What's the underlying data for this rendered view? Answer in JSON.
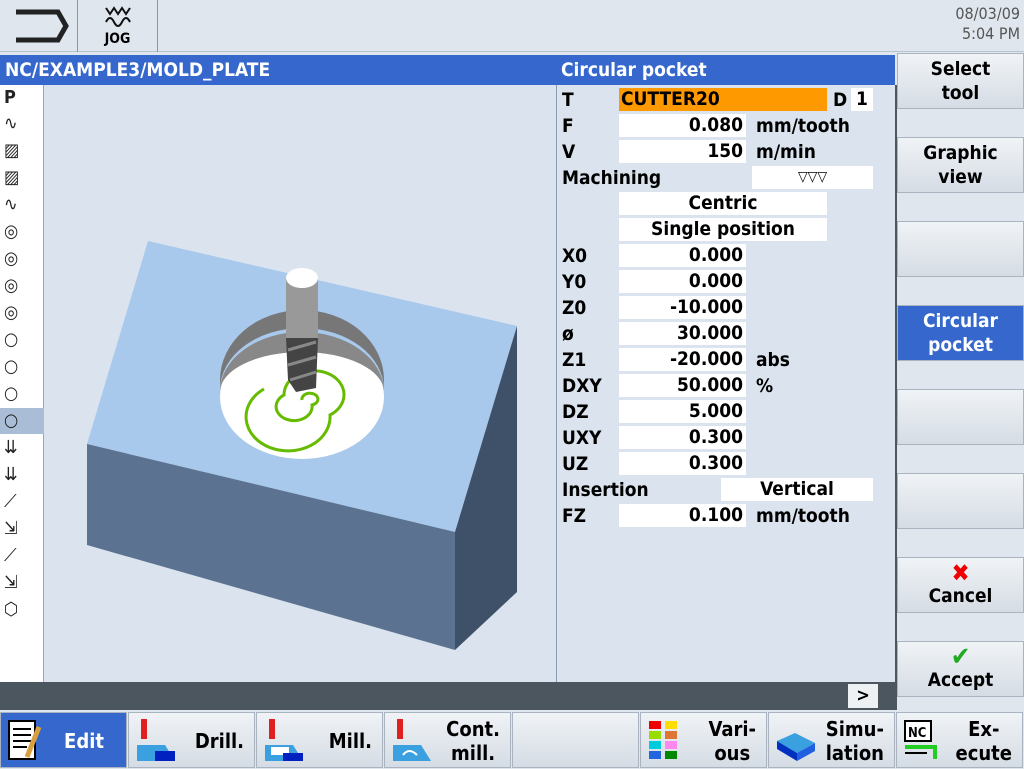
{
  "header": {
    "mode_label": "JOG",
    "date": "08/03/09",
    "time": "5:04 PM"
  },
  "title": {
    "path": "NC/EXAMPLE3/MOLD_PLATE",
    "cycle": "Circular pocket"
  },
  "left_strip": {
    "top_label": "P"
  },
  "form": {
    "tool_label": "T",
    "tool_value": "CUTTER20",
    "d_label": "D",
    "d_value": "1",
    "rows": [
      {
        "label": "F",
        "value": "0.080",
        "unit": "mm/tooth"
      },
      {
        "label": "V",
        "value": "150",
        "unit": "m/min"
      }
    ],
    "machining_label": "Machining",
    "machining_value": "▽▽▽",
    "option1": "Centric",
    "option2": "Single position",
    "params": [
      {
        "label": "X0",
        "value": "0.000",
        "unit": ""
      },
      {
        "label": "Y0",
        "value": "0.000",
        "unit": ""
      },
      {
        "label": "Z0",
        "value": "-10.000",
        "unit": ""
      },
      {
        "label": "ø",
        "value": "30.000",
        "unit": ""
      },
      {
        "label": "Z1",
        "value": "-20.000",
        "unit": "abs"
      },
      {
        "label": "DXY",
        "value": "50.000",
        "unit": "%"
      },
      {
        "label": "DZ",
        "value": "5.000",
        "unit": ""
      },
      {
        "label": "UXY",
        "value": "0.300",
        "unit": ""
      },
      {
        "label": "UZ",
        "value": "0.300",
        "unit": ""
      }
    ],
    "insertion_label": "Insertion",
    "insertion_value": "Vertical",
    "fz": {
      "label": "FZ",
      "value": "0.100",
      "unit": "mm/tooth"
    }
  },
  "softkeys_right": [
    {
      "l1": "Select",
      "l2": "tool"
    },
    {
      "l1": "Graphic",
      "l2": "view"
    },
    {
      "l1": "",
      "l2": ""
    },
    {
      "l1": "Circular",
      "l2": "pocket"
    },
    {
      "l1": "",
      "l2": ""
    },
    {
      "l1": "",
      "l2": ""
    },
    {
      "l1": "Cancel",
      "l2": ""
    },
    {
      "l1": "Accept",
      "l2": ""
    }
  ],
  "more_button": ">",
  "softkeys_bottom": [
    {
      "l1": "Edit",
      "l2": ""
    },
    {
      "l1": "Drill.",
      "l2": ""
    },
    {
      "l1": "Mill.",
      "l2": ""
    },
    {
      "l1": "Cont.",
      "l2": "mill."
    },
    {
      "l1": "",
      "l2": ""
    },
    {
      "l1": "Vari-",
      "l2": "ous"
    },
    {
      "l1": "Simu-",
      "l2": "lation"
    },
    {
      "l1": "Ex-",
      "l2": "ecute"
    }
  ],
  "colors": {
    "accent": "#3567cc",
    "tool_field": "#ff9900",
    "workpiece_top": "#a8c8ec",
    "spiral": "#66bb00"
  }
}
